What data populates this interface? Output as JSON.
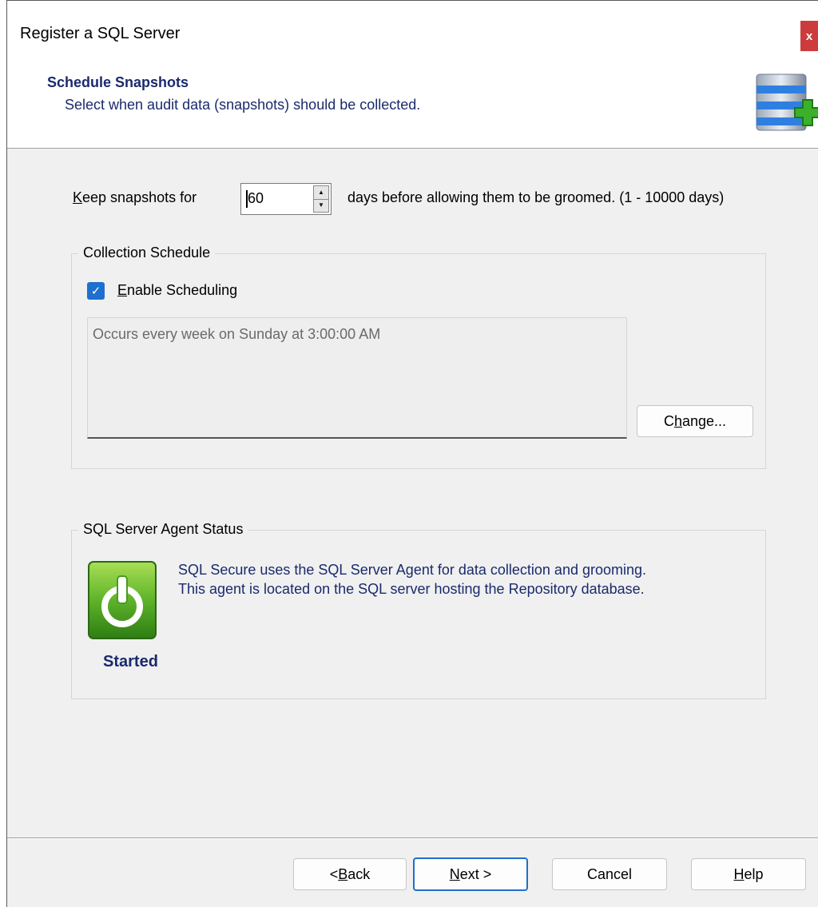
{
  "window": {
    "title": "Register a SQL Server",
    "close_glyph": "x"
  },
  "header": {
    "title": "Schedule Snapshots",
    "subtitle": "Select when audit data (snapshots) should be collected.",
    "icon": "database-add-icon"
  },
  "snapshots": {
    "label_accel": "K",
    "label_rest": "eep snapshots for",
    "days_value": "60",
    "suffix": "days before allowing them to be groomed. (1 - 10000 days)"
  },
  "collection": {
    "group_title": "Collection Schedule",
    "enable_accel": "E",
    "enable_rest": "nable Scheduling",
    "enable_checked": true,
    "schedule_text": "Occurs every week on Sunday at 3:00:00 AM",
    "change_pre": "C",
    "change_accel": "h",
    "change_post": "ange..."
  },
  "agent": {
    "group_title": "SQL Server Agent Status",
    "description_line1": "SQL Secure uses the SQL Server Agent for data collection and grooming.",
    "description_line2": "This agent is located on the SQL server hosting the Repository database.",
    "status": "Started",
    "status_color": "#4caf1a"
  },
  "footer": {
    "back_pre": "< ",
    "back_accel": "B",
    "back_post": "ack",
    "next_accel": "N",
    "next_post": "ext >",
    "cancel": "Cancel",
    "help_accel": "H",
    "help_post": "elp"
  },
  "colors": {
    "accent": "#1f6fcf",
    "header_text": "#1a2a6c",
    "close": "#cd3c3c"
  }
}
